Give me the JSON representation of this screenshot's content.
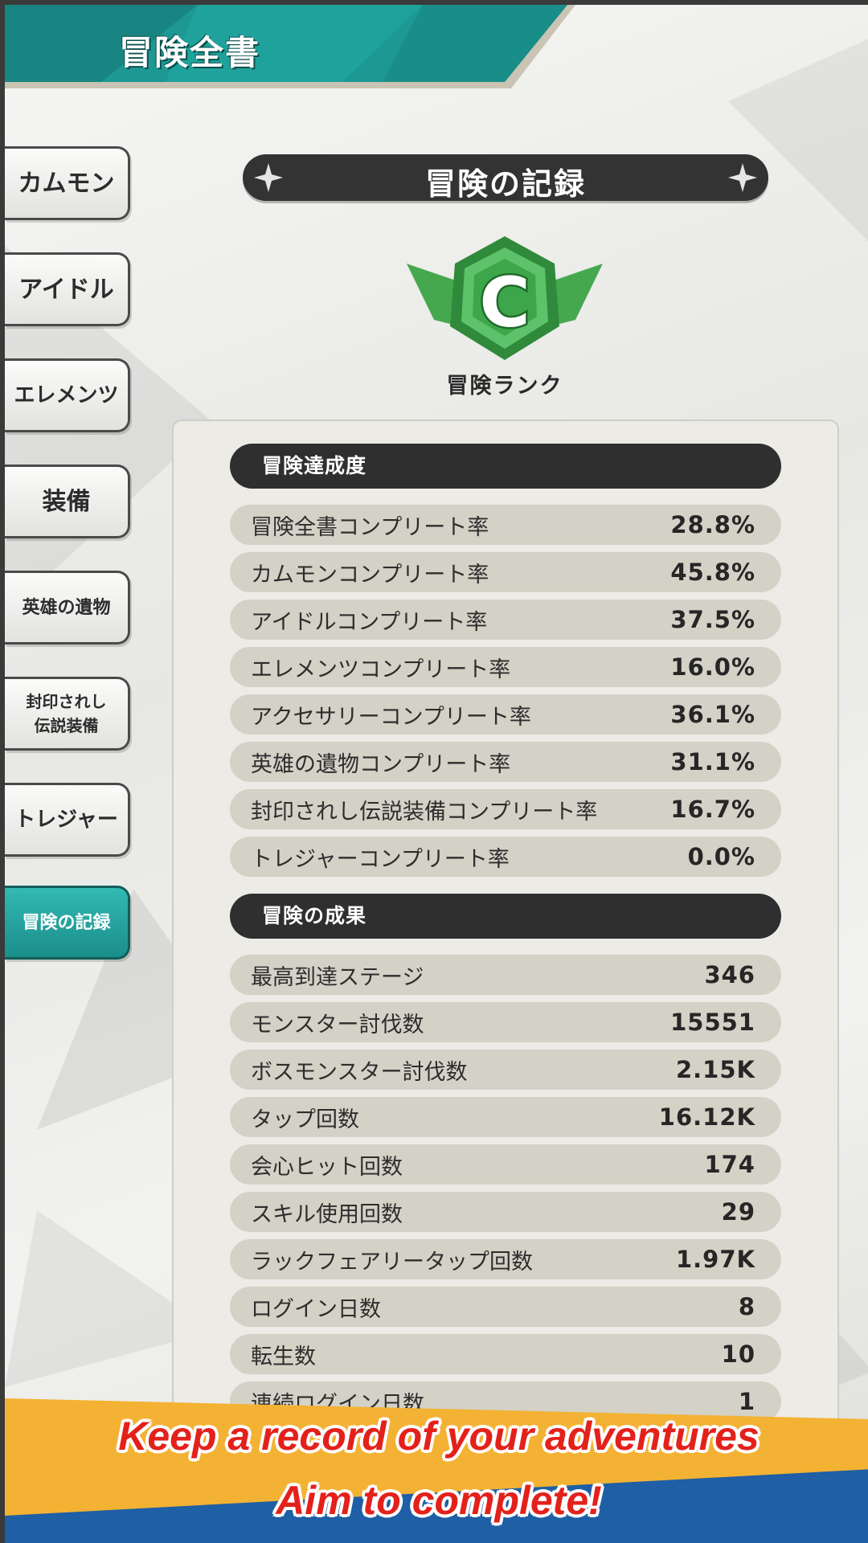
{
  "header": {
    "title": "冒険全書"
  },
  "sidebar": {
    "tabs": [
      {
        "label": "カムモン",
        "active": false
      },
      {
        "label": "アイドル",
        "active": false
      },
      {
        "label": "エレメンツ",
        "active": false
      },
      {
        "label": "装備",
        "active": false
      },
      {
        "label": "英雄の遺物",
        "active": false
      },
      {
        "label_line1": "封印されし",
        "label_line2": "伝説装備",
        "active": false
      },
      {
        "label": "トレジャー",
        "active": false
      },
      {
        "label": "冒険の記録",
        "active": true
      }
    ]
  },
  "main": {
    "title": "冒険の記録",
    "rank": {
      "letter": "C",
      "label": "冒険ランク"
    },
    "achievement": {
      "header": "冒険達成度",
      "rows": [
        {
          "label": "冒険全書コンプリート率",
          "value": "28.8%"
        },
        {
          "label": "カムモンコンプリート率",
          "value": "45.8%"
        },
        {
          "label": "アイドルコンプリート率",
          "value": "37.5%"
        },
        {
          "label": "エレメンツコンプリート率",
          "value": "16.0%"
        },
        {
          "label": "アクセサリーコンプリート率",
          "value": "36.1%"
        },
        {
          "label": "英雄の遺物コンプリート率",
          "value": "31.1%"
        },
        {
          "label": "封印されし伝説装備コンプリート率",
          "value": "16.7%"
        },
        {
          "label": "トレジャーコンプリート率",
          "value": "0.0%"
        }
      ]
    },
    "results": {
      "header": "冒険の成果",
      "rows": [
        {
          "label": "最高到達ステージ",
          "value": "346"
        },
        {
          "label": "モンスター討伐数",
          "value": "15551"
        },
        {
          "label": "ボスモンスター討伐数",
          "value": "2.15K"
        },
        {
          "label": "タップ回数",
          "value": "16.12K"
        },
        {
          "label": "会心ヒット回数",
          "value": "174"
        },
        {
          "label": "スキル使用回数",
          "value": "29"
        },
        {
          "label": "ラックフェアリータップ回数",
          "value": "1.97K"
        },
        {
          "label": "ログイン日数",
          "value": "8"
        },
        {
          "label": "転生数",
          "value": "10"
        },
        {
          "label": "連続ログイン日数",
          "value": "1"
        }
      ]
    }
  },
  "banner": {
    "line1": "Keep a record of  your adventures",
    "line2": "Aim to complete!"
  },
  "colors": {
    "accent_teal": "#1fa29d",
    "dark_bar": "#333333",
    "row_bg": "#d4d1c6",
    "banner_yellow": "#f3b233",
    "banner_blue": "#1e5fa5",
    "banner_text": "#e3211b",
    "rank_green": "#3ea64a"
  }
}
